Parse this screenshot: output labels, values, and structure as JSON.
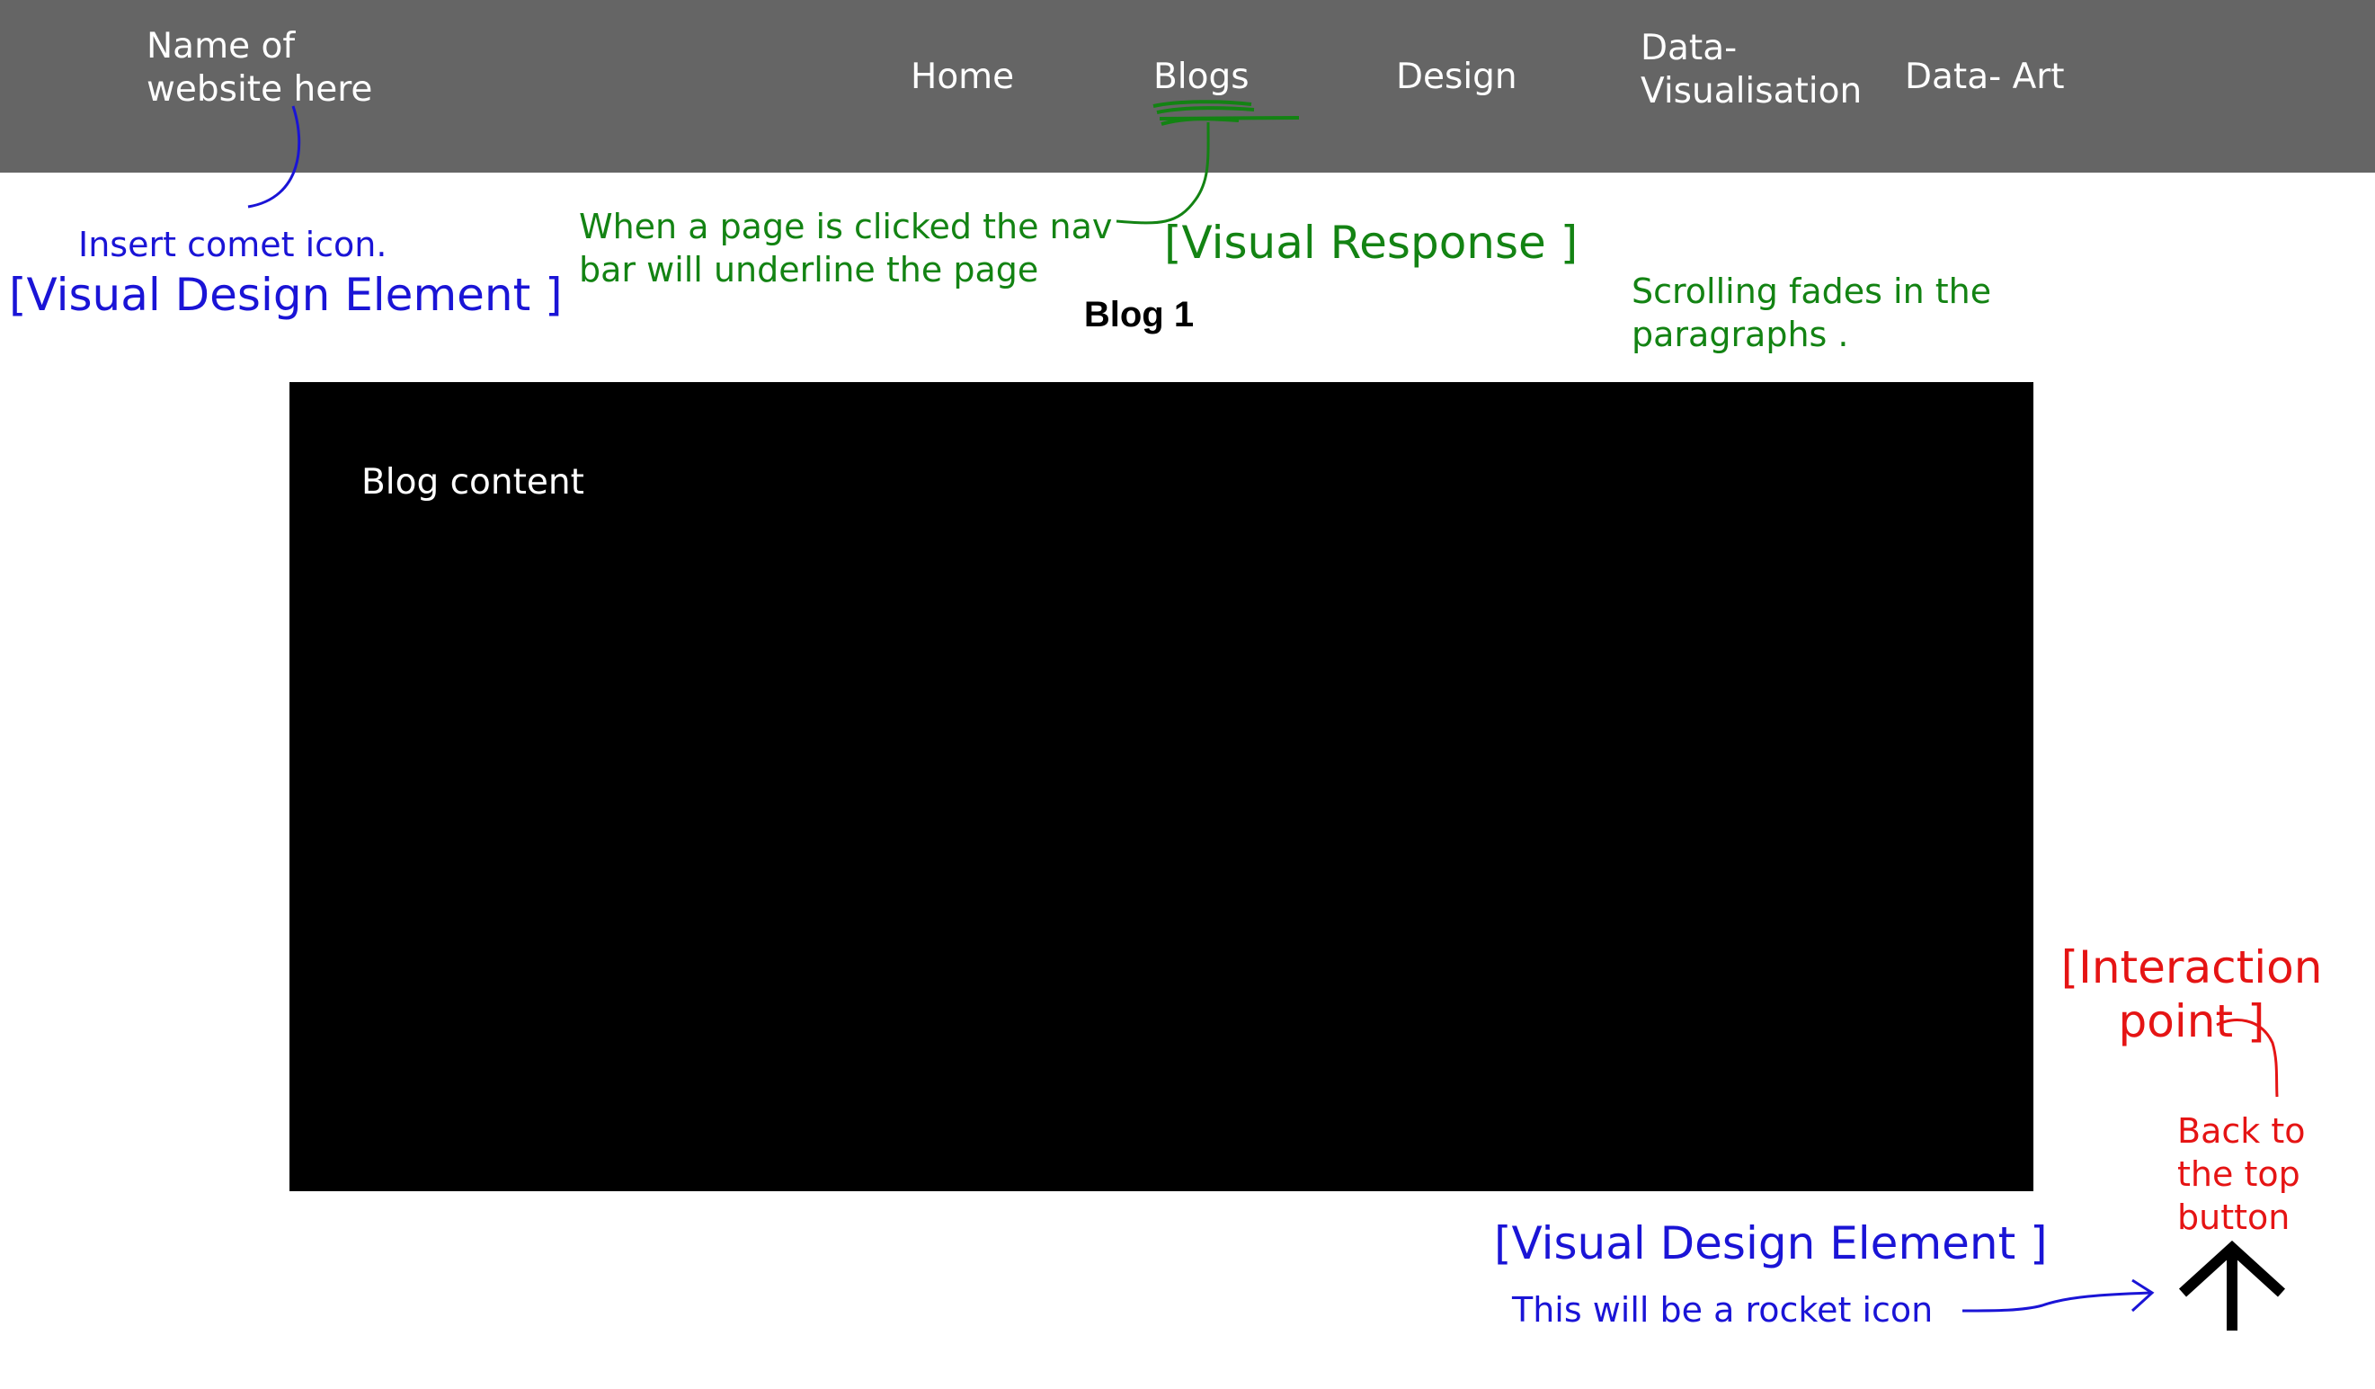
{
  "navbar": {
    "site_name": "Name of website here",
    "items": [
      {
        "label": "Home"
      },
      {
        "label": "Blogs"
      },
      {
        "label": "Design"
      },
      {
        "label": "Data- Visualisation"
      },
      {
        "label": "Data- Art"
      }
    ]
  },
  "annotations": {
    "comet_note": "Insert comet icon.",
    "visual_design_element_top": "[Visual Design Element ]",
    "nav_underline_note": "When a page is clicked the nav bar will underline the page",
    "visual_response": "[Visual Response ]",
    "scroll_note": "Scrolling fades in the paragraphs .",
    "interaction_point": "[Interaction point ]",
    "back_to_top_note": "Back to the  top button",
    "visual_design_element_bottom": "[Visual Design Element ]",
    "rocket_note": "This will be a rocket icon"
  },
  "blog": {
    "title": "Blog 1",
    "content_label": "Blog content"
  },
  "icons": {
    "back_to_top": "arrow-up-icon"
  },
  "colors": {
    "navbar": "#656565",
    "annotation_blue": "#1a14d6",
    "annotation_green": "#138313",
    "annotation_red": "#e51414",
    "blog_box": "#000000"
  }
}
